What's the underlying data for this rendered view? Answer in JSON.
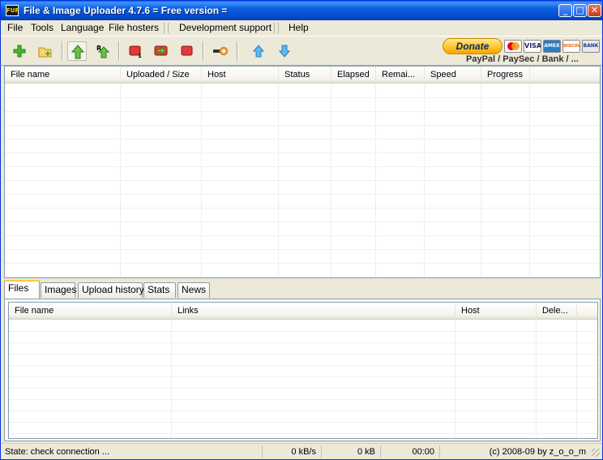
{
  "window": {
    "title": "File & Image Uploader 4.7.6  = Free version =",
    "app_icon_text": "FUP",
    "buttons": {
      "minimize": "_",
      "maximize": "□",
      "close": "✕"
    }
  },
  "menu": {
    "items": [
      "File",
      "Tools",
      "Language",
      "File hosters",
      "Development support",
      "Help"
    ]
  },
  "toolbar": {
    "buttons": [
      {
        "name": "add-files",
        "icon": "plus-icon"
      },
      {
        "name": "add-folder",
        "icon": "folder-add-icon"
      },
      {
        "name": "upload",
        "icon": "upload-arrow-icon"
      },
      {
        "name": "upload-remote",
        "icon": "remote-upload-icon"
      },
      {
        "name": "stop-one",
        "icon": "stop-one-icon"
      },
      {
        "name": "skip",
        "icon": "skip-arrow-icon"
      },
      {
        "name": "stop-all",
        "icon": "stop-icon"
      },
      {
        "name": "settings",
        "icon": "key-icon"
      },
      {
        "name": "move-up",
        "icon": "arrow-up-icon"
      },
      {
        "name": "move-down",
        "icon": "arrow-down-icon"
      }
    ],
    "donate_label": "Donate",
    "payment_text": "PayPal / PaySec / Bank / ...",
    "cards": [
      "MasterCard",
      "VISA",
      "AMEX",
      "DISCOVER",
      "BANK"
    ]
  },
  "upload_list": {
    "columns": [
      "File name",
      "Uploaded / Size",
      "Host",
      "Status",
      "Elapsed",
      "Remai...",
      "Speed",
      "Progress"
    ],
    "rows": []
  },
  "tabs": {
    "labels": [
      "Files",
      "Images",
      "Upload history",
      "Stats",
      "News"
    ],
    "selected": "Files"
  },
  "files_list": {
    "columns": [
      "File name",
      "Links",
      "Host",
      "Dele..."
    ],
    "rows": []
  },
  "statusbar": {
    "state": "State: check connection ...",
    "speed": "0 kB/s",
    "size": "0 kB",
    "time": "00:00",
    "copyright": "(c) 2008-09 by z_o_o_m"
  },
  "colors": {
    "titlebar": "#0a5fe0",
    "window_bg": "#ece9d8",
    "grid_border": "#7f9db9",
    "donate": "#ffc52b",
    "tab_highlight": "#ffc83c"
  }
}
